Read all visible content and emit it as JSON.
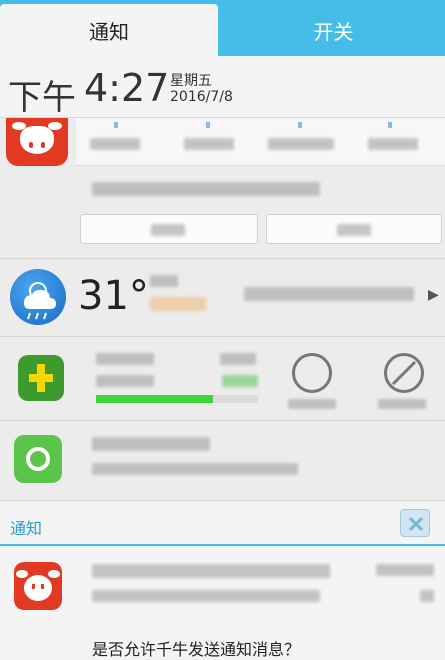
{
  "tabs": {
    "notifications": "通知",
    "switches": "开关"
  },
  "header": {
    "ampm": "下午",
    "time": "4:27",
    "weekday": "星期五",
    "date": "2016/7/8"
  },
  "weather": {
    "temperature": "31°"
  },
  "section": {
    "label": "通知"
  },
  "bottom_notification": {
    "question": "是否允许千牛发送通知消息？"
  },
  "security": {
    "progress": 0.72
  },
  "colors": {
    "accent": "#45bde8",
    "brand_red": "#e23a22",
    "progress_green": "#3cd53a"
  }
}
